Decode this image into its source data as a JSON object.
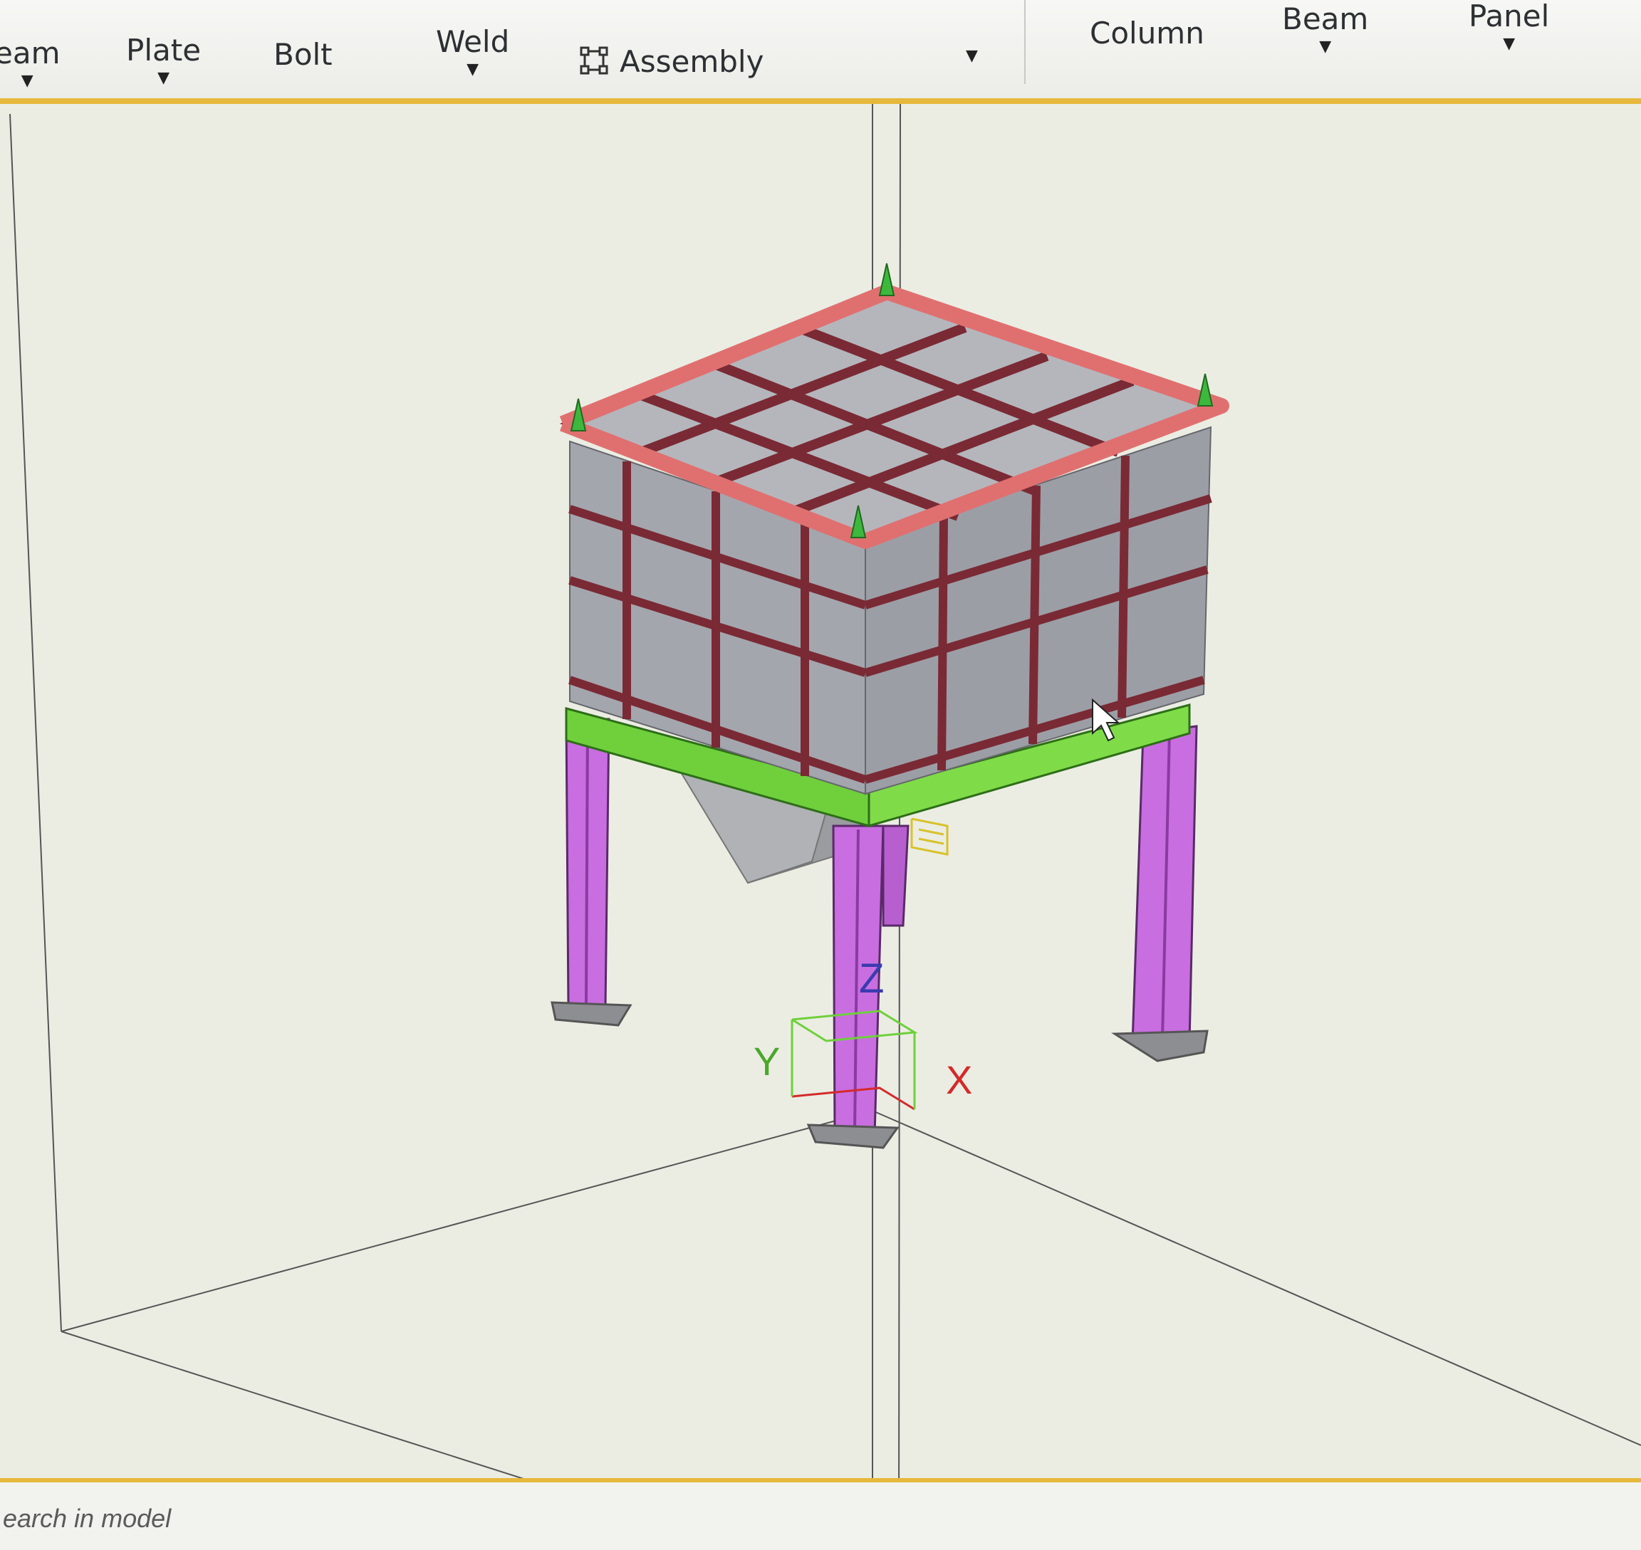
{
  "ribbon": {
    "items": [
      {
        "label": "eam",
        "has_dropdown": true
      },
      {
        "label": "Plate",
        "has_dropdown": true
      },
      {
        "label": "Bolt",
        "has_dropdown": false
      },
      {
        "label": "Weld",
        "has_dropdown": true
      },
      {
        "label": "Assembly",
        "has_dropdown": true,
        "icon": "assembly-icon"
      },
      {
        "label": "Column",
        "has_dropdown": false
      },
      {
        "label": "Beam",
        "has_dropdown": true
      },
      {
        "label": "Panel",
        "has_dropdown": true
      }
    ],
    "accent_color": "#e6b93c"
  },
  "viewport": {
    "axes": {
      "x": "X",
      "y": "Y",
      "z": "Z"
    },
    "colors": {
      "roof_beams": "#e07070",
      "frame_members": "#7a2a34",
      "panels": "#9ea0a8",
      "base_beams": "#6fd03c",
      "columns": "#c86ee0",
      "support_markers": "#3db83d",
      "x_axis": "#d42a2a",
      "y_axis": "#4aa82a",
      "z_axis": "#3b3bb0"
    }
  },
  "statusbar": {
    "search_placeholder": "earch in model"
  }
}
